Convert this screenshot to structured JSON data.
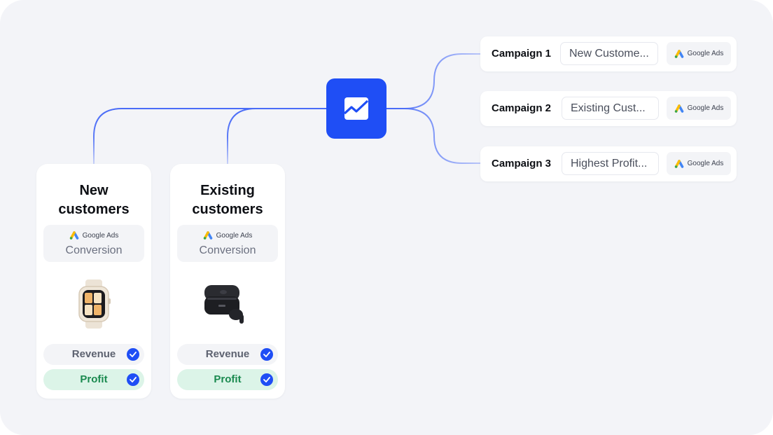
{
  "diagram": {
    "hub": {
      "icon": "trend-chart-icon",
      "color": "#1f4ef5"
    },
    "accent_color": "#1f4ef5",
    "segments": [
      {
        "title_line1": "New",
        "title_line2": "customers",
        "source": "Google Ads",
        "metric": "Conversion",
        "product_icon": "smartwatch-image",
        "goals": [
          {
            "label": "Revenue",
            "checked": true
          },
          {
            "label": "Profit",
            "checked": true
          }
        ]
      },
      {
        "title_line1": "Existing",
        "title_line2": "customers",
        "source": "Google Ads",
        "metric": "Conversion",
        "product_icon": "earbuds-image",
        "goals": [
          {
            "label": "Revenue",
            "checked": true
          },
          {
            "label": "Profit",
            "checked": true
          }
        ]
      }
    ],
    "campaigns": [
      {
        "name": "Campaign 1",
        "value": "New Custome...",
        "source": "Google Ads"
      },
      {
        "name": "Campaign 2",
        "value": "Existing Cust...",
        "source": "Google Ads"
      },
      {
        "name": "Campaign 3",
        "value": "Highest Profit...",
        "source": "Google Ads"
      }
    ]
  }
}
